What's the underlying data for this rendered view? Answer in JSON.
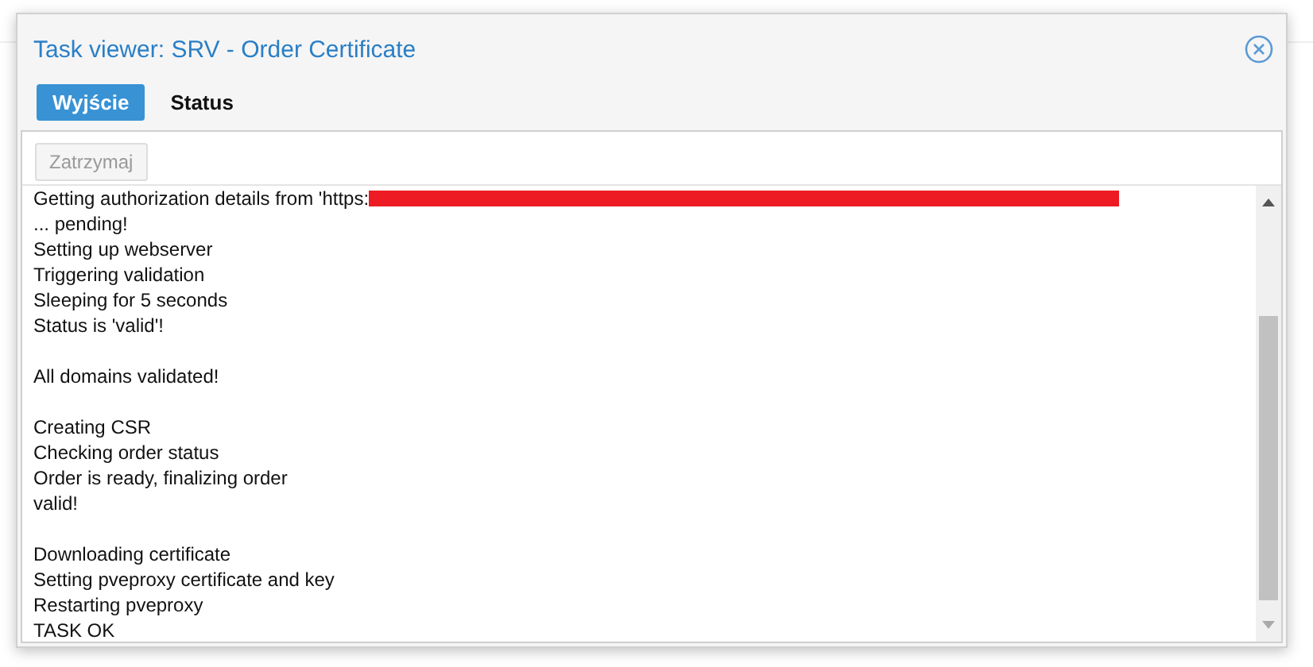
{
  "window": {
    "title": "Task viewer: SRV - Order Certificate"
  },
  "tabs": [
    {
      "label": "Wyjście",
      "selected": true
    },
    {
      "label": "Status",
      "selected": false
    }
  ],
  "toolbar": {
    "button": {
      "label": "Zatrzymaj",
      "disabled": true
    }
  },
  "log": {
    "first_line_redacted": true,
    "paragraphs": [
      [
        "Getting authorization details from 'https:",
        "... pending!",
        "Setting up webserver",
        "Triggering validation",
        "Sleeping for 5 seconds",
        "Status is 'valid'!"
      ],
      [
        "All domains validated!"
      ],
      [
        "Creating CSR",
        "Checking order status",
        "Order is ready, finalizing order",
        "valid!"
      ],
      [
        "Downloading certificate",
        "Setting pveproxy certificate and key",
        "Restarting pveproxy",
        "TASK OK"
      ]
    ]
  }
}
